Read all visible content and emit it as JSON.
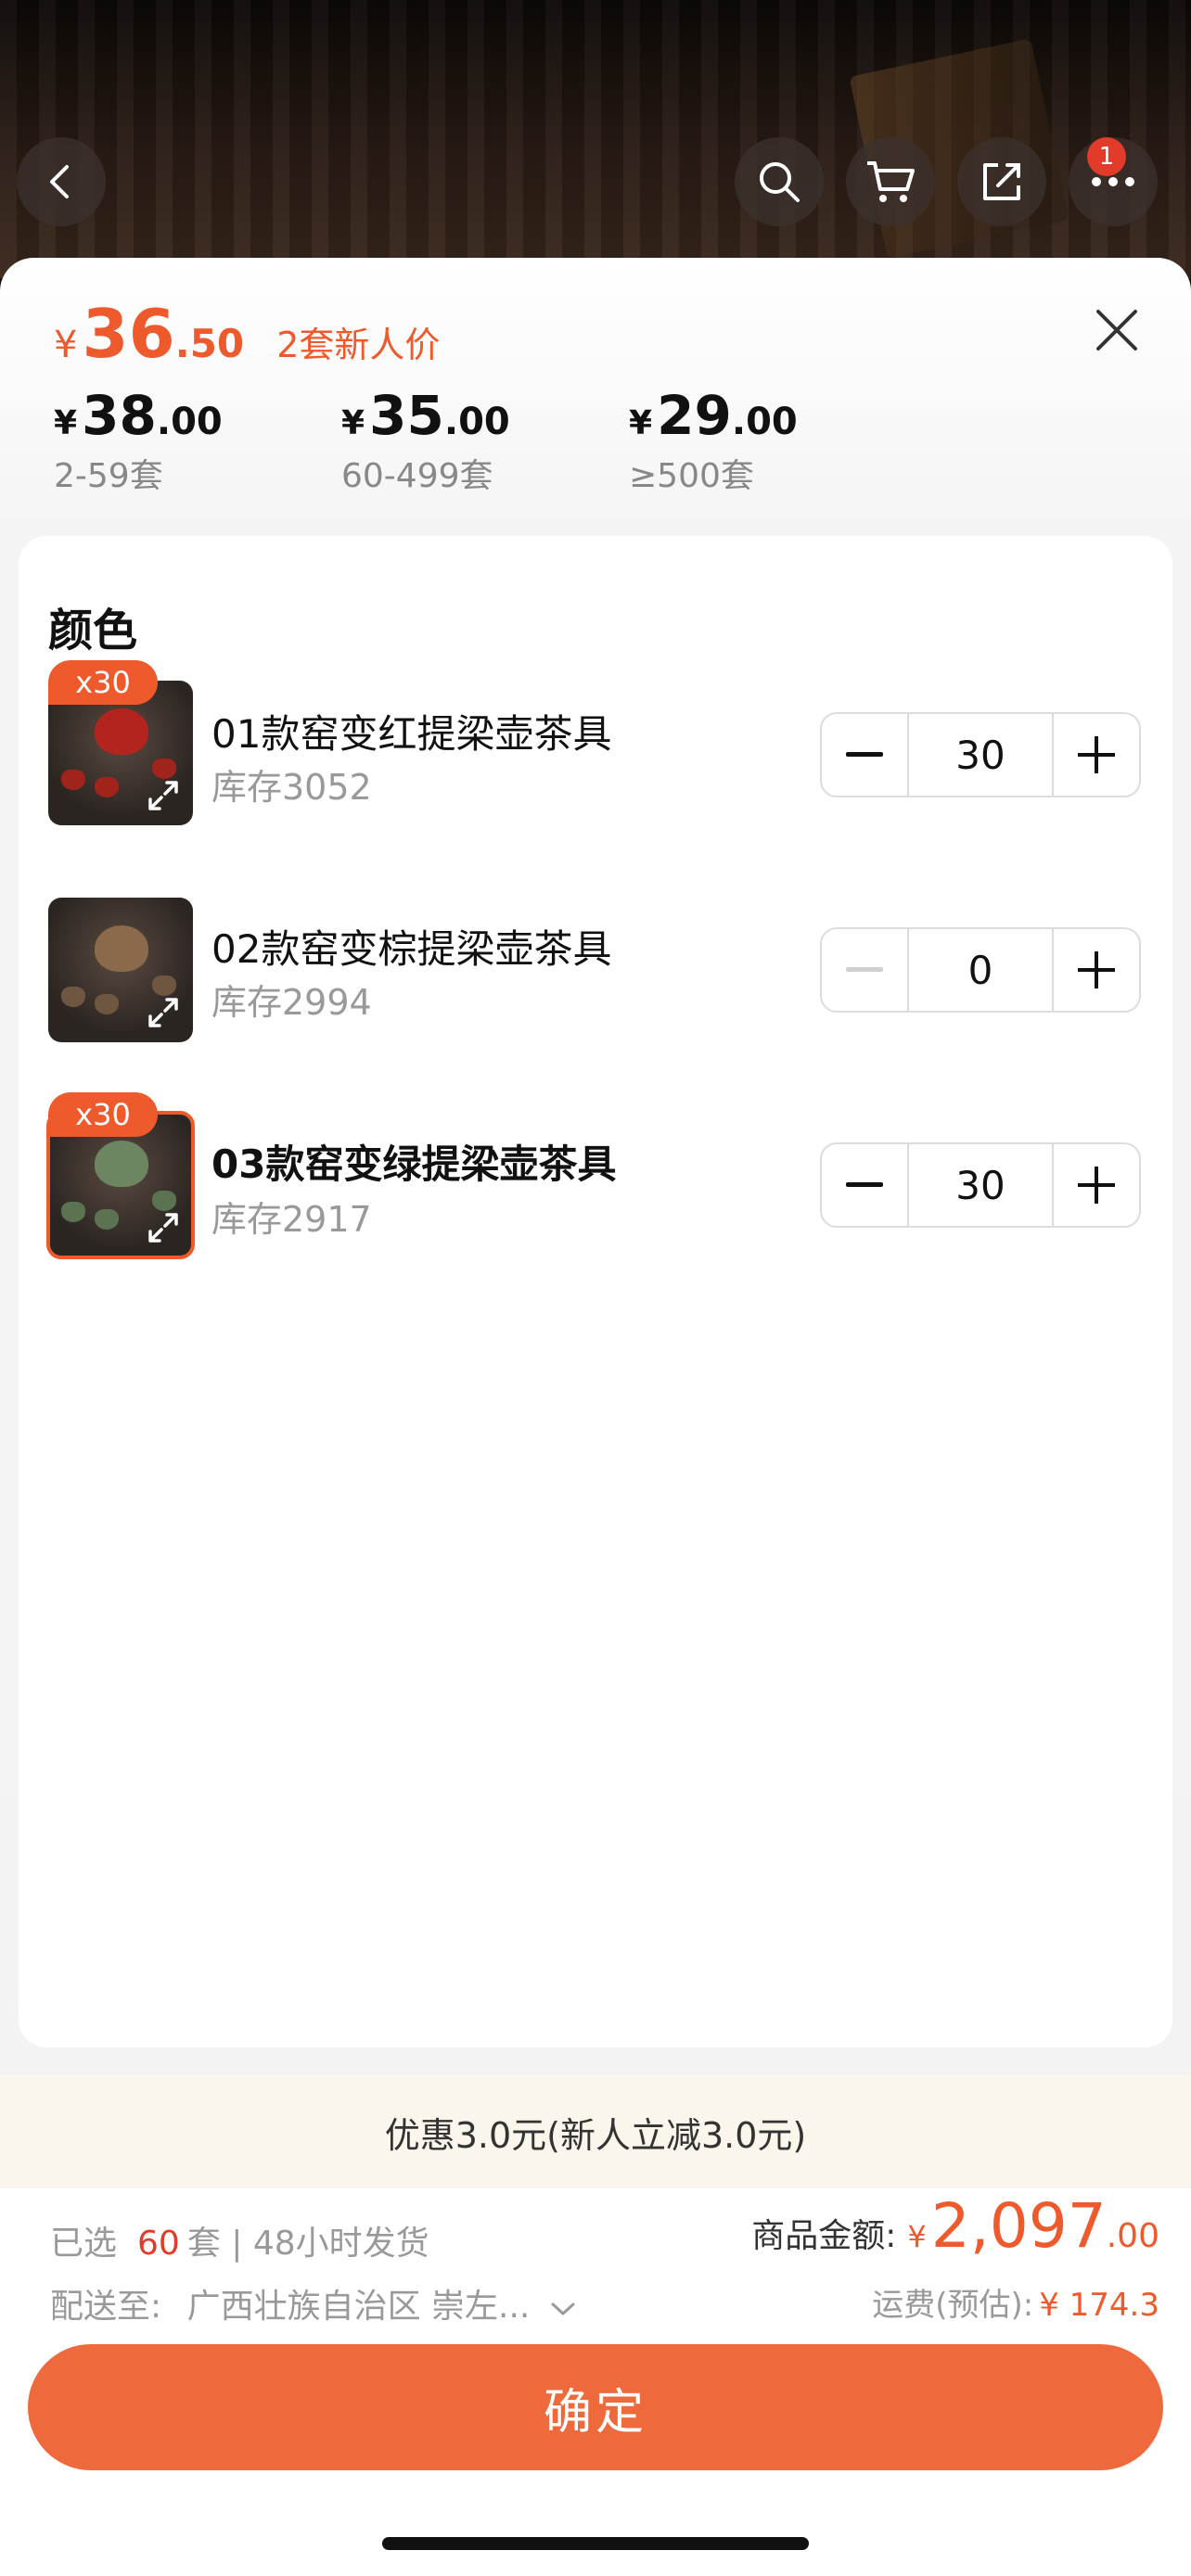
{
  "header": {
    "cart_badge": "1",
    "icons": [
      "back-icon",
      "search-icon",
      "cart-icon",
      "share-icon",
      "more-icon"
    ]
  },
  "price": {
    "currency": "¥",
    "current_int": "36",
    "current_dec": ".50",
    "current_tag": "2套新人价",
    "tiers": [
      {
        "int": "38",
        "dec": ".00",
        "range": "2-59套"
      },
      {
        "int": "35",
        "dec": ".00",
        "range": "60-499套"
      },
      {
        "int": "29",
        "dec": ".00",
        "range": "≥500套"
      }
    ]
  },
  "section_title": "颜色",
  "skus": [
    {
      "badge": "x30",
      "name": "01款窑变红提梁壶茶具",
      "stock": "库存3052",
      "qty": "30"
    },
    {
      "badge": "",
      "name": "02款窑变棕提梁壶茶具",
      "stock": "库存2994",
      "qty": "0"
    },
    {
      "badge": "x30",
      "name": "03款窑变绿提梁壶茶具",
      "stock": "库存2917",
      "qty": "30"
    }
  ],
  "promo": "优惠3.0元(新人立减3.0元)",
  "footer": {
    "selected_prefix": "已选",
    "selected_count": "60",
    "selected_suffix": "套 | 48小时发货",
    "ship_label": "配送至:",
    "ship_address": "广西壮族自治区 崇左...",
    "total_label": "商品金额:",
    "total_currency": "¥",
    "total_int": "2,097",
    "total_dec": ".00",
    "fee_label": "运费(预估):",
    "fee_value": "¥ 174.3",
    "confirm_label": "确定"
  },
  "colors": {
    "accent": "#ee5a2c",
    "button": "#ee6a3c"
  }
}
